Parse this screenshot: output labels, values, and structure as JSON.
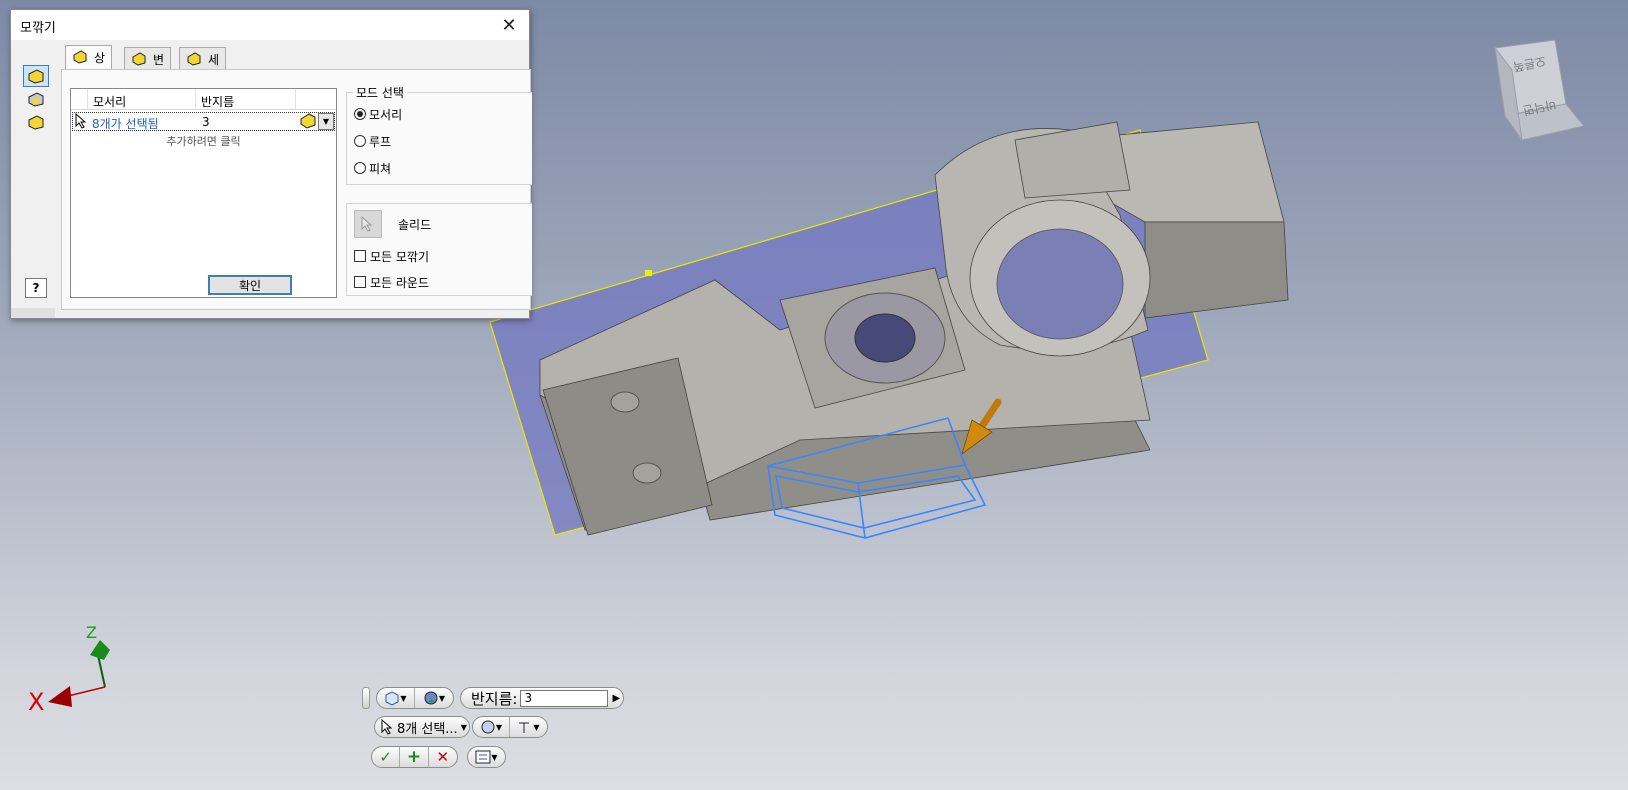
{
  "dialog": {
    "title": "모깎기",
    "close_icon": "close-icon",
    "tabs": [
      {
        "label": "상수",
        "icon": "fillet-constant-icon"
      },
      {
        "label": "변수",
        "icon": "fillet-variable-icon"
      },
      {
        "label": "세트백",
        "icon": "setback-icon"
      }
    ],
    "side_tools": [
      "edge-fillet-icon",
      "face-fillet-icon",
      "full-round-fillet-icon"
    ],
    "help_label": "?",
    "grid": {
      "col_edge": "모서리",
      "col_radius": "반지름",
      "row_edges": "8개가 선택됨",
      "row_radius": "3",
      "add_hint": "추가하려면 클릭"
    },
    "ok_label": "확인",
    "mode": {
      "title": "모드 선택",
      "options": [
        "모서리",
        "루프",
        "피쳐"
      ],
      "selected": "모서리"
    },
    "solid_label": "솔리드",
    "all_fillets_label": "모든 모깎기",
    "all_rounds_label": "모든 라운드"
  },
  "minitoolbar": {
    "radius_label": "반지름:",
    "radius_value": "3",
    "selection_label": "8개 선택...",
    "apply_icon": "checkmark-icon",
    "add_icon": "plus-icon",
    "cancel_icon": "x-icon"
  },
  "triad": {
    "x_label": "X",
    "z_label": "Z"
  },
  "viewcube": {
    "face_labels": [
      "오른쪽",
      "바닥면"
    ]
  },
  "colors": {
    "model_face": "#b5b4ae",
    "model_dark": "#8a8984",
    "work_plane": "#7378c0",
    "selection_blue": "#3a86ff",
    "plane_border": "#f0f000",
    "arrow": "#d08a10"
  }
}
